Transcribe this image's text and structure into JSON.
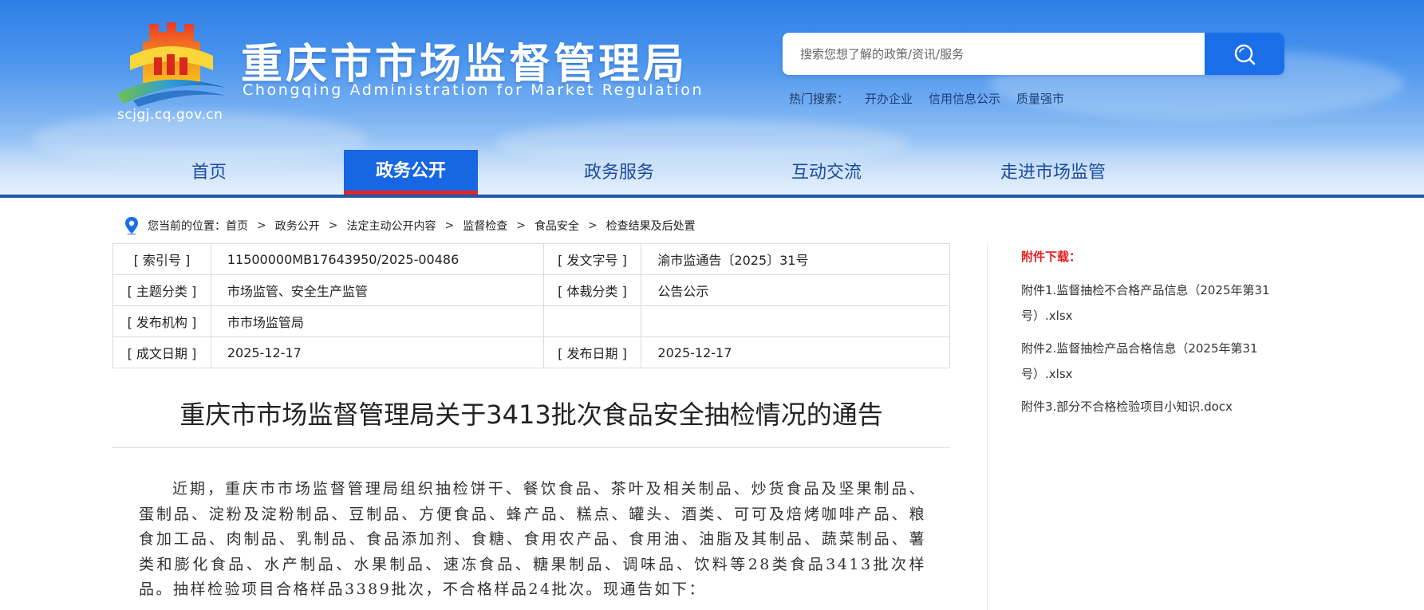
{
  "header": {
    "title": "重庆市市场监督管理局",
    "subtitle": "Chongqing  Administration for Market Regulation",
    "site_url": "scjgj.cq.gov.cn"
  },
  "search": {
    "placeholder": "搜索您想了解的政策/资讯/服务",
    "value": "",
    "hot_label": "热门搜索：",
    "hot_terms": [
      "开办企业",
      "信用信息公示",
      "质量强市"
    ]
  },
  "nav": {
    "items": [
      {
        "label": "首页"
      },
      {
        "label": "政务公开",
        "active": true
      },
      {
        "label": "政务服务"
      },
      {
        "label": "互动交流"
      },
      {
        "label": "走进市场监管"
      }
    ]
  },
  "breadcrumb": {
    "prefix": "您当前的位置：",
    "items": [
      "首页",
      "政务公开",
      "法定主动公开内容",
      "监督检查",
      "食品安全",
      "检查结果及后处置"
    ],
    "separator": ">"
  },
  "meta": {
    "rows": [
      {
        "k1": "[ 索引号 ]",
        "v1": "11500000MB17643950/2025-00486",
        "k2": "[ 发文字号 ]",
        "v2": "渝市监通告〔2025〕31号"
      },
      {
        "k1": "[ 主题分类 ]",
        "v1": "市场监管、安全生产监管",
        "k2": "[ 体裁分类 ]",
        "v2": "公告公示"
      },
      {
        "k1": "[ 发布机构 ]",
        "v1": "市市场监管局",
        "k2": "",
        "v2": ""
      },
      {
        "k1": "[ 成文日期 ]",
        "v1": "2025-12-17",
        "k2": "[ 发布日期 ]",
        "v2": "2025-12-17"
      }
    ]
  },
  "attachments": {
    "title": "附件下载：",
    "items": [
      "附件1.监督抽检不合格产品信息（2025年第31号）.xlsx",
      "附件2.监督抽检产品合格信息（2025年第31号）.xlsx",
      "附件3.部分不合格检验项目小知识.docx"
    ]
  },
  "article": {
    "title": "重庆市市场监督管理局关于3413批次食品安全抽检情况的通告",
    "body": "近期，重庆市市场监督管理局组织抽检饼干、餐饮食品、茶叶及相关制品、炒货食品及坚果制品、蛋制品、淀粉及淀粉制品、豆制品、方便食品、蜂产品、糕点、罐头、酒类、可可及焙烤咖啡产品、粮食加工品、肉制品、乳制品、食品添加剂、食糖、食用农产品、食用油、油脂及其制品、蔬菜制品、薯类和膨化食品、水产制品、水果制品、速冻食品、糖果制品、调味品、饮料等28类食品3413批次样品。抽样检验项目合格样品3389批次，不合格样品24批次。现通告如下："
  },
  "colors": {
    "header_top": "#2d7fe6",
    "nav_active_bg": "#1766e2",
    "nav_active_underline": "#e32525",
    "nav_text": "#1d4c9e",
    "search_button": "#1a6fe8",
    "attachment_title": "#e02020"
  }
}
